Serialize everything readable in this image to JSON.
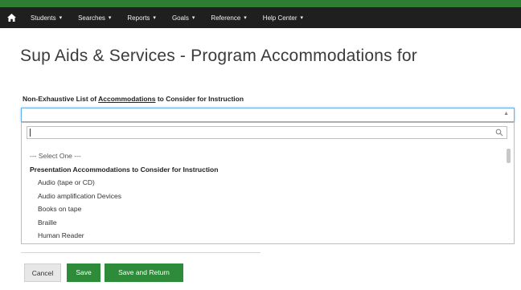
{
  "nav": {
    "items": [
      {
        "label": "Students"
      },
      {
        "label": "Searches"
      },
      {
        "label": "Reports"
      },
      {
        "label": "Goals"
      },
      {
        "label": "Reference"
      },
      {
        "label": "Help Center"
      }
    ],
    "caret": "▾"
  },
  "page": {
    "title": "Sup Aids & Services - Program Accommodations for"
  },
  "field": {
    "label_prefix": "Non-Exhaustive List of ",
    "label_link": "Accommodations",
    "label_suffix": " to Consider for Instruction"
  },
  "dropdown": {
    "search_value": "",
    "placeholder_option": "--- Select One ---",
    "group_label": "Presentation Accommodations to Consider for Instruction",
    "options": [
      "Audio (tape or CD)",
      "Audio amplification Devices",
      "Books on tape",
      "Braille",
      "Human Reader"
    ]
  },
  "buttons": {
    "cancel": "Cancel",
    "save": "Save",
    "save_return": "Save and Return"
  },
  "colors": {
    "brand_green": "#2e8b3a",
    "navbar": "#1f1f1f",
    "focus_blue": "#66afe9"
  },
  "icons": {
    "home": "home-icon",
    "search": "search-icon",
    "select_arrow": "chevron-down-icon"
  }
}
